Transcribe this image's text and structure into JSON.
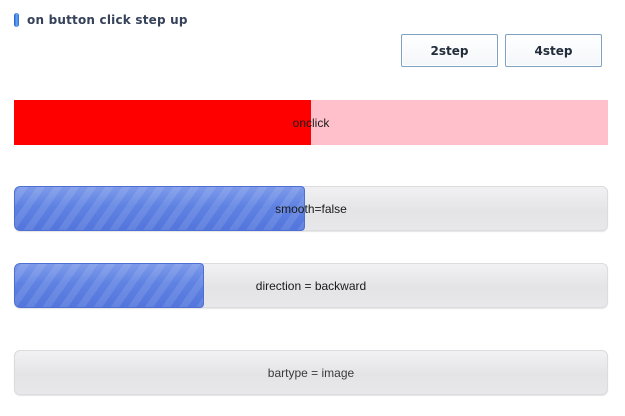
{
  "header": {
    "title": "on button click step up",
    "icon": "pill-icon",
    "icon_color": "#2a6bd0"
  },
  "buttons": {
    "step2_label": "2step",
    "step4_label": "4step"
  },
  "progress_bars": [
    {
      "label": "onclick",
      "progress_percent": 50,
      "fill_color": "#ff0000",
      "track_color": "#ffc0cb"
    },
    {
      "label": "smooth=false",
      "progress_percent": 49,
      "fill_color": "#5f82e2",
      "track_color": "#e6e6e8"
    },
    {
      "label": "direction = backward",
      "progress_percent": 32,
      "fill_color": "#5f82e2",
      "track_color": "#e6e6e8"
    },
    {
      "label": "bartype = image",
      "progress_percent": 0,
      "fill_color": "#5f82e2",
      "track_color": "#e6e6e8"
    }
  ]
}
